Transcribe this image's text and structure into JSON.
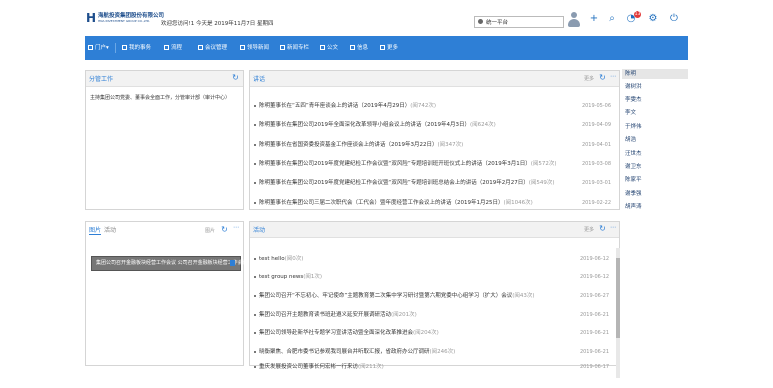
{
  "header": {
    "logo_text": "海航投资集团股份有限公司",
    "logo_sub": "HNA INVESTMENT GROUP CO.,LTD.",
    "greeting": "欢迎您访问!1 今天是 2019年11月7日 星期四",
    "platform_label": "统一平台",
    "notification_count": "13"
  },
  "nav": {
    "items": [
      {
        "label": "门户"
      },
      {
        "label": "我的事务"
      },
      {
        "label": "流程"
      },
      {
        "label": "会议管理"
      },
      {
        "label": "领导新闻"
      },
      {
        "label": "新闻专栏"
      },
      {
        "label": "公文"
      },
      {
        "label": "信息"
      },
      {
        "label": "更多"
      }
    ]
  },
  "work_panel": {
    "title": "分管工作",
    "text": "主持集团公司党委、董事会全面工作，分管审计部（审计中心）"
  },
  "speech_panel": {
    "title": "讲话",
    "more": "更多",
    "rows": [
      {
        "text": "陈明董事长在“五四”青年座谈会上的讲话（2019年4月29日）",
        "hits": "(阅742次)",
        "date": "2019-05-06"
      },
      {
        "text": "陈明董事长在集团公司2019年全面深化改革领导小组会议上的讲话（2019年4月3日）",
        "hits": "(阅624次)",
        "date": "2019-04-09"
      },
      {
        "text": "陈明董事长在省国资委投资基金工作座谈会上的讲话（2019年3月22日）",
        "hits": "(阅347次)",
        "date": "2019-04-01"
      },
      {
        "text": "陈明董事长在集团公司2019年度党建纪检工作会议暨“双风险”专题培训班开班仪式上的讲话（2019年3月1日）",
        "hits": "(阅572次)",
        "date": "2019-03-08"
      },
      {
        "text": "陈明董事长在集团公司2019年度党建纪检工作会议暨“双风险”专题培训班总结会上的讲话（2019年2月27日）",
        "hits": "(阅549次)",
        "date": "2019-03-01"
      },
      {
        "text": "陈明董事长在集团公司三届二次职代会（工代会）暨年度经营工作会议上的讲话（2019年1月25日）",
        "hits": "(阅1046次)",
        "date": "2019-02-22"
      }
    ]
  },
  "image_panel": {
    "tab_image": "图片",
    "tab_activity": "活动",
    "more": "图片",
    "caption": "集团公司召开金融板块经营工作会议 公司召开金融板块经营工作会议"
  },
  "activity_panel": {
    "title": "活动",
    "more": "更多",
    "rows": [
      {
        "text": "test hello",
        "hits": "(阅0次)",
        "date": "2019-06-12"
      },
      {
        "text": "test group news",
        "hits": "(阅1次)",
        "date": "2019-06-12"
      },
      {
        "text": "集团公司召开“不忘初心、牢记使命”主题教育第二次集中学习研讨暨第六期党委中心组学习（扩大）会议",
        "hits": "(阅43次)",
        "date": "2019-06-27"
      },
      {
        "text": "集团公司召开主题教育读书班赴遵义延安开展调研活动",
        "hits": "(阅201次)",
        "date": "2019-06-21"
      },
      {
        "text": "集团公司领导赴新华社专题学习宣讲活动暨全面深化改革推进会",
        "hits": "(阅204次)",
        "date": "2019-06-21"
      },
      {
        "text": "晓衡聚焦、合肥市委书记参观我司展台并听取汇报，省政府办公厅调研",
        "hits": "(阅246次)",
        "date": "2019-06-21"
      },
      {
        "text": "重庆发展投资公司董事长何宏彬一行来访",
        "hits": "(阅211次)",
        "date": "2019-06-17"
      }
    ]
  },
  "sidebar": {
    "items": [
      {
        "label": "陈明"
      },
      {
        "label": "谢树洪"
      },
      {
        "label": "李雯杰"
      },
      {
        "label": "李文"
      },
      {
        "label": "于烨伟"
      },
      {
        "label": "胡浩"
      },
      {
        "label": "汪世杰"
      },
      {
        "label": "谢卫东"
      },
      {
        "label": "陈家平"
      },
      {
        "label": "谢季强"
      },
      {
        "label": "胡声涛"
      }
    ]
  },
  "colors": {
    "accent": "#2e7fd6",
    "badge": "#e23b3b"
  }
}
